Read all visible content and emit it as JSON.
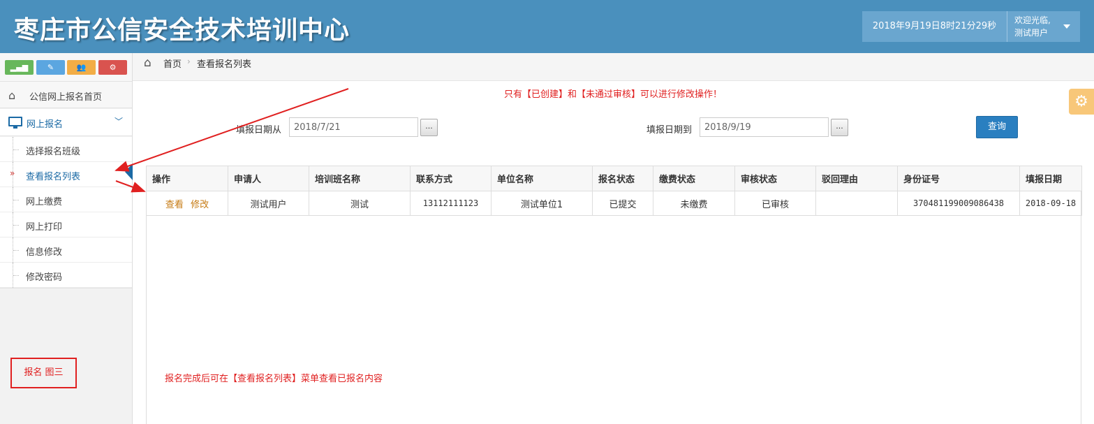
{
  "header": {
    "title": "枣庄市公信安全技术培训中心",
    "datetime": "2018年9月19日8时21分29秒",
    "welcome": "欢迎光临,",
    "username": "测试用户",
    "colors": {
      "bar": "#4a90bd",
      "user_box": "#6aa6cf"
    }
  },
  "sidebar": {
    "shortcuts": [
      {
        "icon": "signal-icon",
        "glyph": "▂▄▆",
        "color": "#68b75b"
      },
      {
        "icon": "pencil-icon",
        "glyph": "✎",
        "color": "#5ba6e0"
      },
      {
        "icon": "users-icon",
        "glyph": "👥",
        "color": "#f2ad46"
      },
      {
        "icon": "cogs-icon",
        "glyph": "⚙",
        "color": "#d9534f"
      }
    ],
    "home_label": "公信网上报名首页",
    "group_label": "网上报名",
    "items": [
      {
        "label": "选择报名班级"
      },
      {
        "label": "查看报名列表",
        "marker": "»"
      },
      {
        "label": "网上缴费"
      },
      {
        "label": "网上打印"
      },
      {
        "label": "信息修改"
      },
      {
        "label": "修改密码"
      }
    ],
    "note": "报名 图三"
  },
  "breadcrumb": {
    "home": "首页",
    "separator": "›",
    "current": "查看报名列表"
  },
  "main": {
    "notice": "只有【已创建】和【未通过审核】可以进行修改操作！",
    "date_from_label": "填报日期从",
    "date_from_value": "2018/7/21",
    "date_to_label": "填报日期到",
    "date_to_value": "2018/9/19",
    "picker_label": "...",
    "query_label": "查询",
    "instruction": "报名完成后可在【查看报名列表】菜单查看已报名内容"
  },
  "table": {
    "columns": [
      "操作",
      "申请人",
      "培训班名称",
      "联系方式",
      "单位名称",
      "报名状态",
      "缴费状态",
      "审核状态",
      "驳回理由",
      "身份证号",
      "填报日期"
    ],
    "rows": [
      {
        "actions": [
          "查看",
          "修改"
        ],
        "applicant": "测试用户",
        "class_name": "测试",
        "contact": "13112111123",
        "unit": "测试单位1",
        "signup_status": "已提交",
        "payment_status": "未缴费",
        "review_status": "已审核",
        "reject_reason": "",
        "id_number": "370481199009086438",
        "date": "2018-09-18"
      }
    ]
  },
  "colors": {
    "link": "#1b6aa5",
    "warning": "#e02020",
    "action": "#c67a12",
    "primary_button": "#2a7fc0"
  }
}
